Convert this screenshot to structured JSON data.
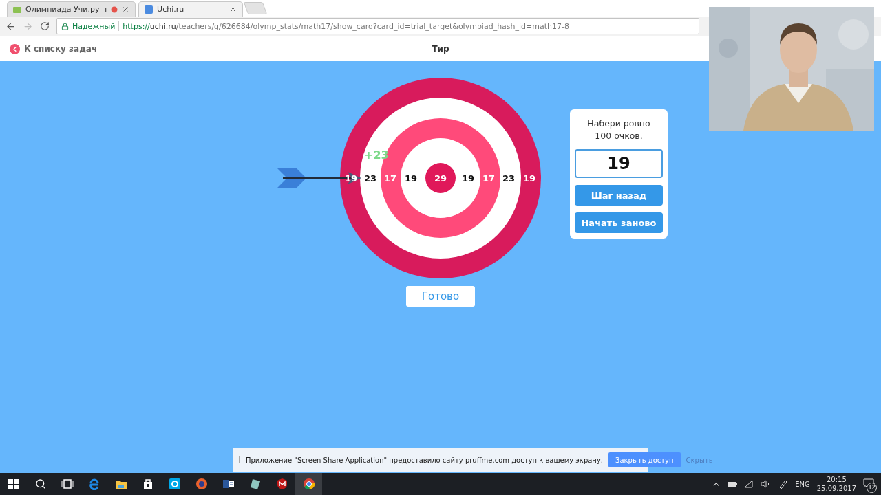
{
  "browser": {
    "tabs": [
      {
        "title": "Олимпиада Учи.ру п",
        "selected": false,
        "recording": true
      },
      {
        "title": "Uchi.ru",
        "selected": true,
        "recording": false
      }
    ],
    "security_label": "Надежный",
    "url": {
      "scheme": "https://",
      "host": "uchi.ru",
      "path": "/teachers/g/626684/olymp_stats/math17/show_card?card_id=trial_target&olympiad_hash_id=math17-8"
    }
  },
  "page": {
    "back_link": "К списку задач",
    "title": "Тир"
  },
  "game": {
    "scores": [
      "19",
      "23",
      "17",
      "19",
      "29",
      "19",
      "17",
      "23",
      "19"
    ],
    "hit_popup": "+23",
    "prompt": "Набери ровно 100 очков.",
    "current_sum": "19",
    "buttons": [
      "Шаг назад",
      "Начать заново"
    ],
    "done_button": "Готово"
  },
  "share_bar": {
    "message": "Приложение \"Screen Share Application\" предоставило сайту pruffme.com доступ к вашему экрану.",
    "stop_button": "Закрыть доступ",
    "hide_link": "Скрыть"
  },
  "taskbar": {
    "language": "ENG",
    "time": "20:15",
    "date": "25.09.2017",
    "notifications": "12"
  }
}
